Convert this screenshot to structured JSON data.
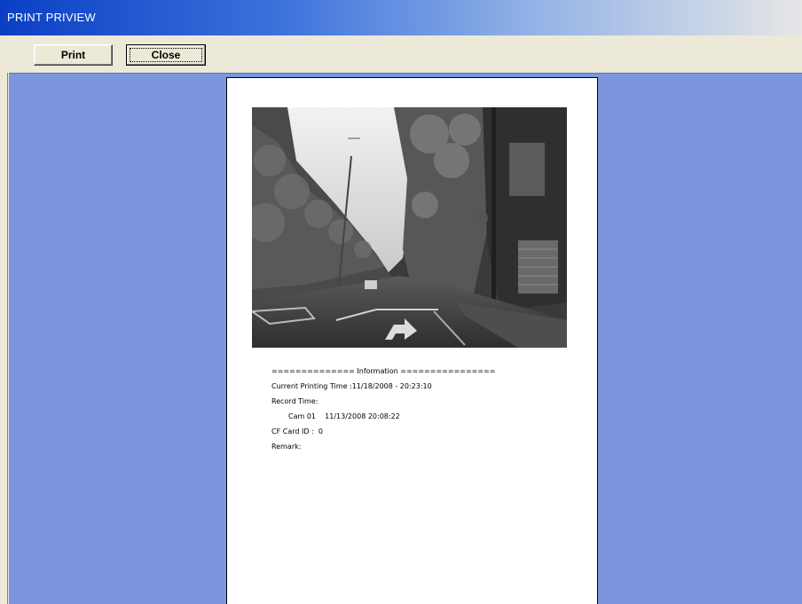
{
  "window": {
    "title": "PRINT PRIVIEW"
  },
  "toolbar": {
    "print_label": "Print",
    "close_label": "Close"
  },
  "page": {
    "info_header": "============== Information ================",
    "current_printing_time": "Current Printing Time :11/18/2008 - 20:23:10",
    "record_time_label": "Record Time:",
    "cam_record": "Cam 01    11/13/2008 20:08:22",
    "cf_card_id": "CF Card ID :  0",
    "remark": "Remark:"
  }
}
